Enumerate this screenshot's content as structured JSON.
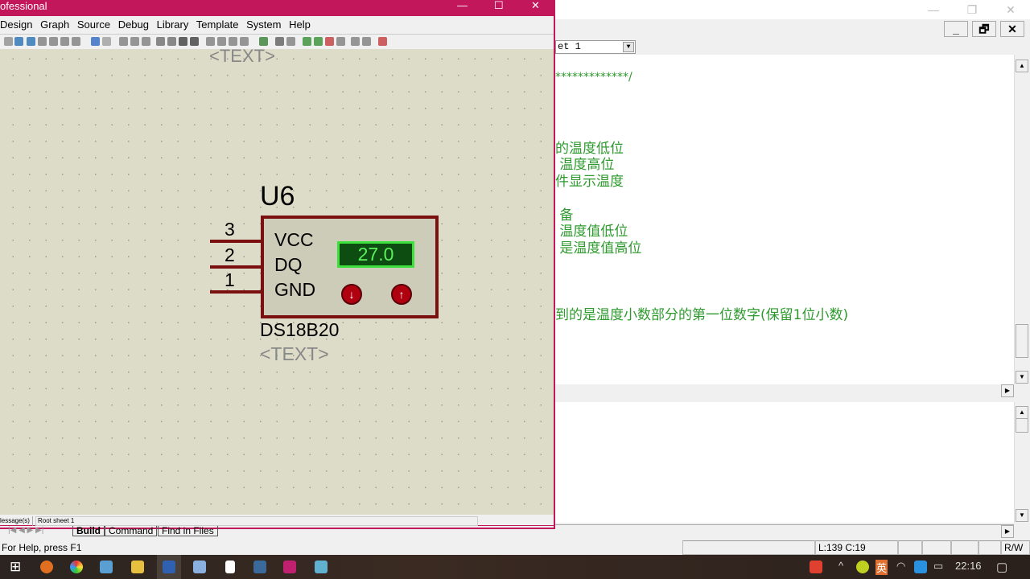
{
  "left_window": {
    "title": "ofessional",
    "menu": [
      "Design",
      "Graph",
      "Source",
      "Debug",
      "Library",
      "Template",
      "System",
      "Help"
    ],
    "schematic": {
      "top_text": "<TEXT>",
      "ref": "U6",
      "pins": [
        {
          "num": "3",
          "name": "VCC"
        },
        {
          "num": "2",
          "name": "DQ"
        },
        {
          "num": "1",
          "name": "GND"
        }
      ],
      "display_value": "27.0",
      "part": "DS18B20",
      "text": "<TEXT>"
    },
    "status": {
      "messages": "lessage(s)",
      "sheet": "Root sheet 1"
    },
    "tabs": [
      "Build",
      "Command",
      "Find in Files"
    ],
    "help": "For Help, press F1"
  },
  "right_window": {
    "sheet_select": "et 1",
    "code_lines": [
      "*************/",
      "的温度低位",
      " 温度高位",
      "件显示温度",
      " 备",
      " 温度值低位",
      " 是温度值高位",
      "到的是温度小数部分的第一位数字(保留1位小数)"
    ],
    "status": {
      "position": "L:139 C:19",
      "mode": "R/W"
    }
  },
  "taskbar": {
    "clock": "22:16",
    "ime": "英",
    "apps": [
      "search",
      "chrome",
      "files",
      "explorer",
      "isis",
      "paint",
      "notepad",
      "viewer",
      "app",
      "app2"
    ]
  },
  "colors": {
    "title": "#c2185b",
    "code": "#2e9a2e",
    "canvas": "#dddcc9",
    "component": "#7a1010",
    "lcd": "#0d4d12"
  }
}
